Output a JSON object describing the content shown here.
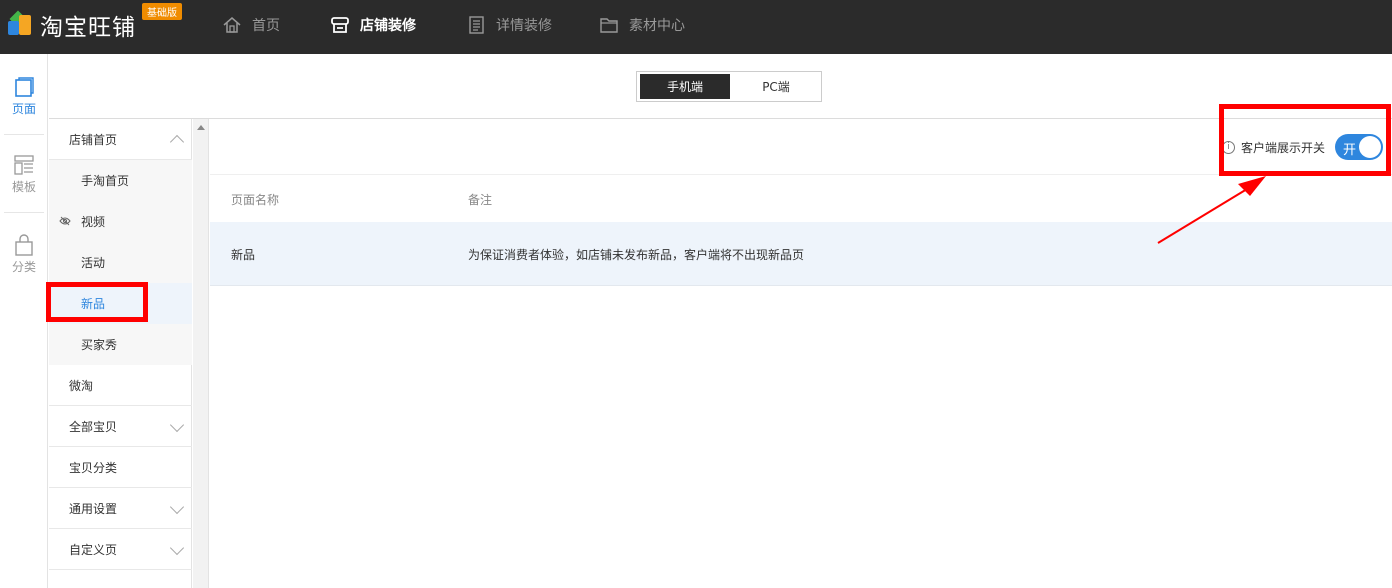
{
  "app": {
    "logo_text": "淘宝旺铺",
    "edition_badge": "基础版"
  },
  "topnav": [
    {
      "label": "首页",
      "icon": "home-icon",
      "active": false
    },
    {
      "label": "店铺装修",
      "icon": "store-icon",
      "active": true
    },
    {
      "label": "详情装修",
      "icon": "document-icon",
      "active": false
    },
    {
      "label": "素材中心",
      "icon": "folder-icon",
      "active": false
    }
  ],
  "rail": [
    {
      "label": "页面",
      "icon": "page-icon",
      "active": true
    },
    {
      "label": "模板",
      "icon": "template-icon",
      "active": false
    },
    {
      "label": "分类",
      "icon": "bag-icon",
      "active": false
    }
  ],
  "device_toggle": {
    "mobile": "手机端",
    "pc": "PC端",
    "selected": "手机端"
  },
  "tree": {
    "store_home": "店铺首页",
    "mobile_home": "手淘首页",
    "video": "视频",
    "activity": "活动",
    "new_products": "新品",
    "buyer_show": "买家秀",
    "weitao": "微淘",
    "all_items": "全部宝贝",
    "item_category": "宝贝分类",
    "general_settings": "通用设置",
    "custom_page": "自定义页"
  },
  "client_switch": {
    "label": "客户端展示开关",
    "state_text": "开",
    "on": true
  },
  "table": {
    "headers": {
      "name": "页面名称",
      "note": "备注"
    },
    "rows": [
      {
        "name": "新品",
        "note": "为保证消费者体验，如店铺未发布新品，客户端将不出现新品页"
      }
    ]
  },
  "colors": {
    "topbar_bg": "#2b2b2b",
    "accent": "#2e86de",
    "annotation": "#ff0000",
    "badge": "#f08c00"
  }
}
